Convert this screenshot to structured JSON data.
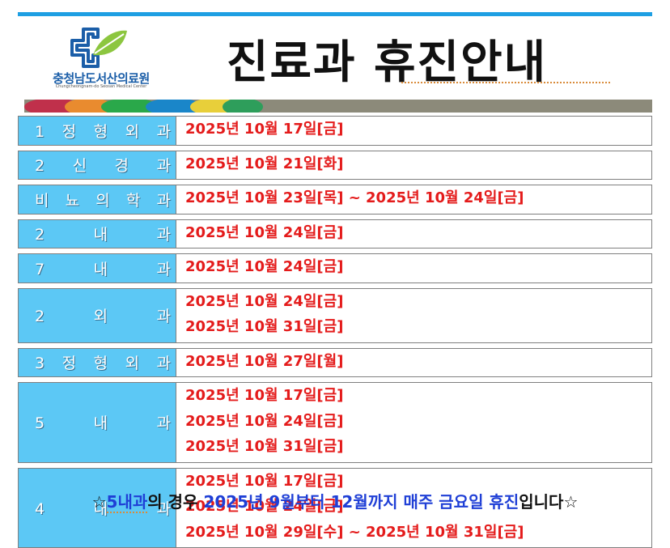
{
  "logo": {
    "name": "충청남도서산의료원",
    "subtitle": "Chungcheongnam-do Seosan Medical Center"
  },
  "title": "진료과 휴진안내",
  "rows": [
    {
      "dept": "1정형외과",
      "dates": [
        "2025년 10월 17일[금]"
      ]
    },
    {
      "dept": "2신경과",
      "dates": [
        "2025년 10월 21일[화]"
      ]
    },
    {
      "dept": "비뇨의학과",
      "dates": [
        "2025년 10월 23일[목] ~ 2025년 10월 24일[금]"
      ]
    },
    {
      "dept": "2내과",
      "dates": [
        "2025년 10월 24일[금]"
      ]
    },
    {
      "dept": "7내과",
      "dates": [
        "2025년 10월 24일[금]"
      ]
    },
    {
      "dept": "2외과",
      "dates": [
        "2025년 10월 24일[금]",
        "2025년 10월 31일[금]"
      ]
    },
    {
      "dept": "3정형외과",
      "dates": [
        "2025년 10월 27일[월]"
      ]
    },
    {
      "dept": "5내과",
      "dates": [
        "2025년 10월 17일[금]",
        "2025년 10월 24일[금]",
        "2025년 10월 31일[금]"
      ]
    },
    {
      "dept": "4내과",
      "dates": [
        "2025년 10월 17일[금]",
        "2025년 10월 24일[금]",
        "2025년 10월 29일[수] ~ 2025년 10월 31일[금]"
      ]
    }
  ],
  "footer": {
    "star_left": "☆",
    "blue1": "5내과",
    "text1": "의 경우 ",
    "blue2": "2025년 9월부터 12월까지 매주 금요일 휴진",
    "text2": "입니다",
    "star_right": "☆"
  },
  "colors": {
    "accent_bar": "#1e9fe3",
    "dept_cell": "#5cc8f5",
    "date_text": "#e41b1b",
    "footer_blue": "#1f3fd6"
  }
}
